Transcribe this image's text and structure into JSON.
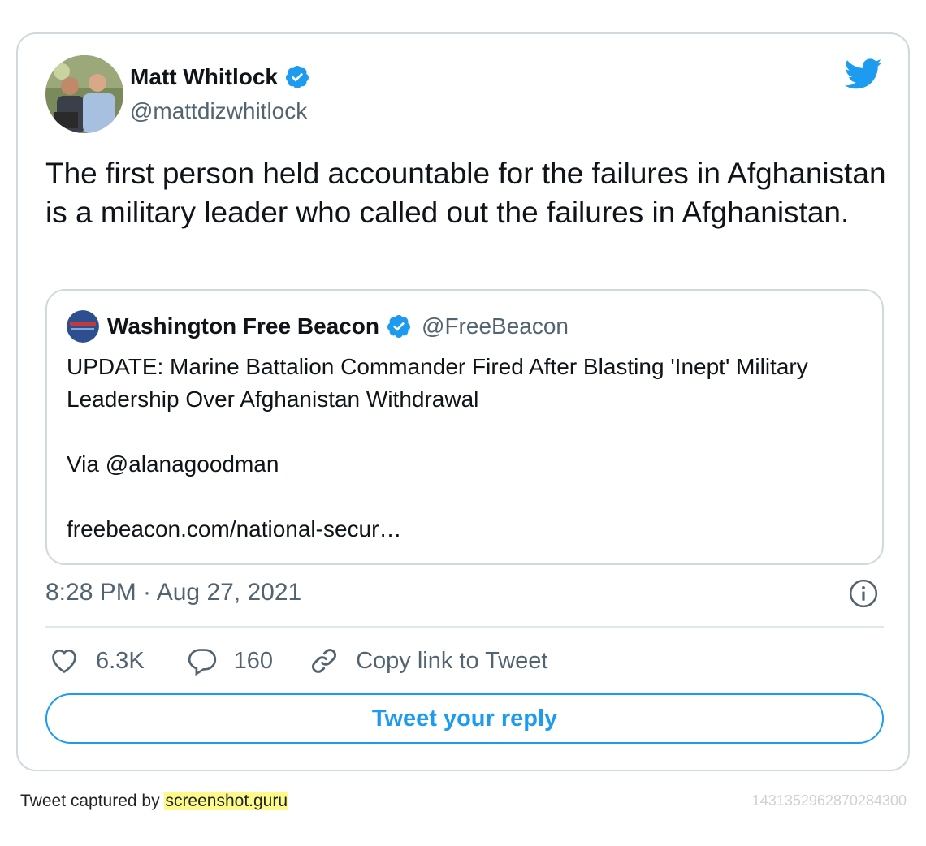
{
  "author": {
    "name": "Matt Whitlock",
    "handle": "@mattdizwhitlock",
    "verified": true
  },
  "tweet": {
    "text": "The first person held accountable for the failures in Afghanistan is a military leader who called out the failures in Afghanistan.",
    "timestamp": "8:28 PM · Aug 27, 2021"
  },
  "quoted": {
    "name": "Washington Free Beacon",
    "handle": "@FreeBeacon",
    "verified": true,
    "line1": "UPDATE: Marine Battalion Commander Fired After Blasting 'Inept' Military Leadership Over Afghanistan Withdrawal",
    "line2": "Via @alanagoodman",
    "line3": "freebeacon.com/national-secur…"
  },
  "actions": {
    "likes": "6.3K",
    "replies": "160",
    "copy_link": "Copy link to Tweet"
  },
  "reply_button": "Tweet your reply",
  "footer": {
    "captured_by": "Tweet captured by ",
    "site": "screenshot.guru",
    "tweet_id": "1431352962870284300"
  },
  "colors": {
    "accent": "#1d9bf0",
    "text_secondary": "#536471",
    "border": "#cfd9de"
  }
}
